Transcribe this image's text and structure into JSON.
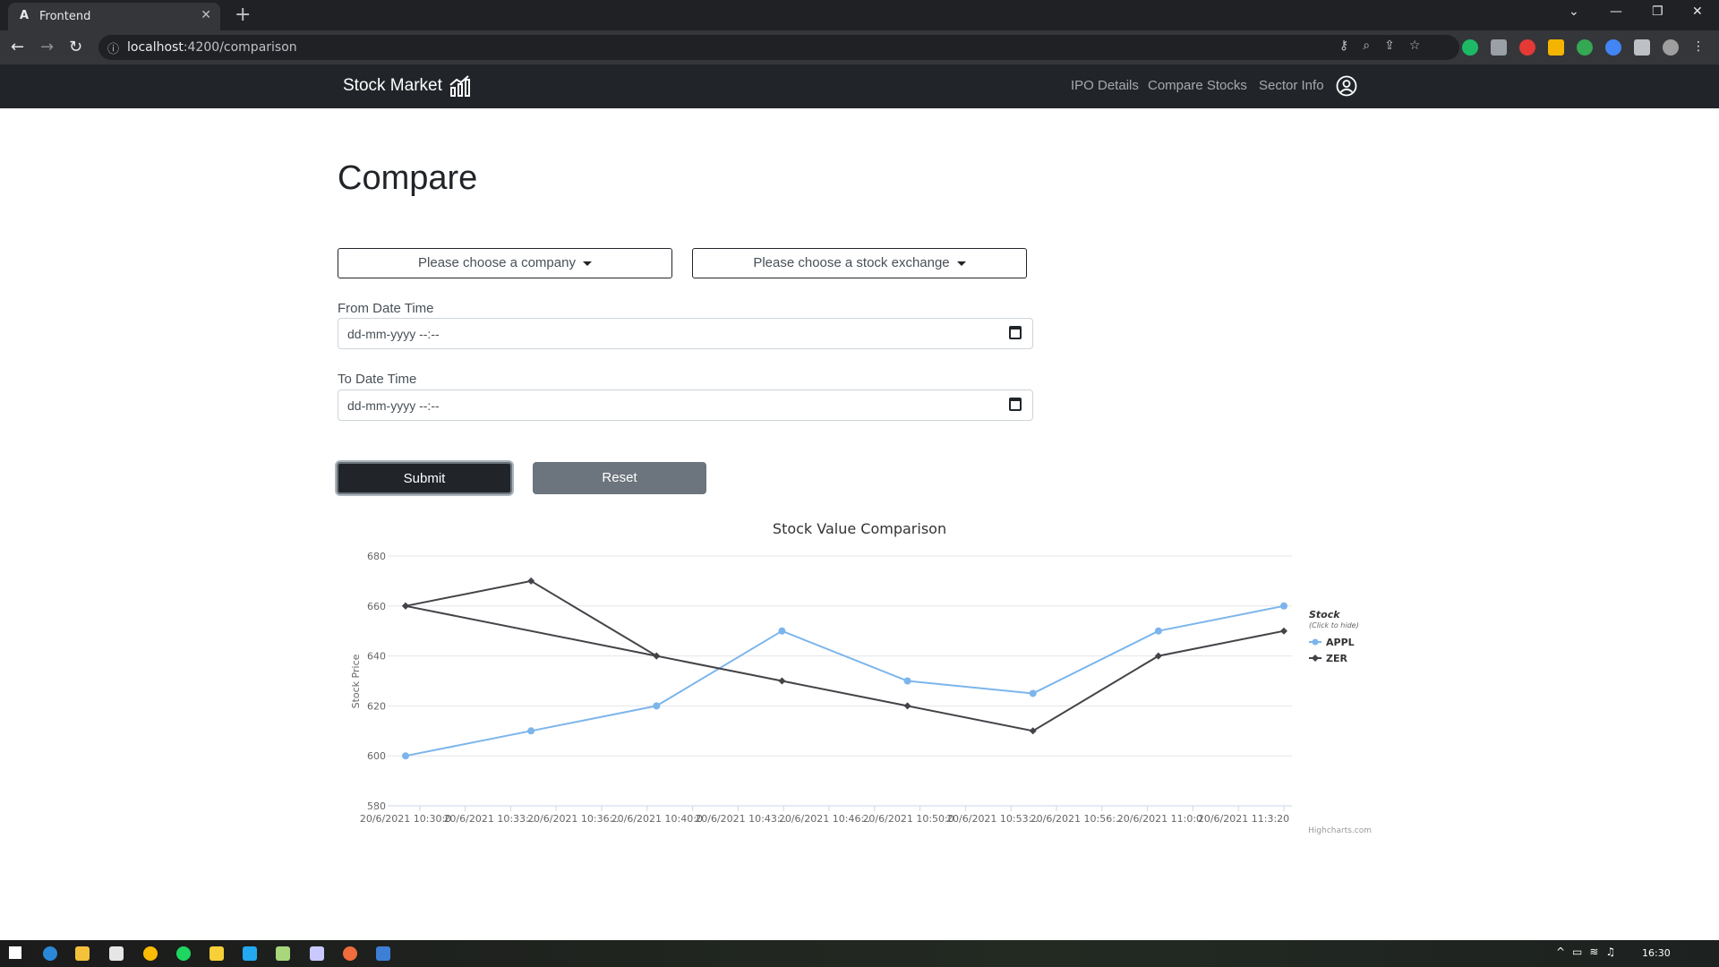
{
  "browser": {
    "tab_title": "Frontend",
    "tab_favicon": "A",
    "url_host": "localhost",
    "url_path": ":4200/comparison"
  },
  "navbar": {
    "brand": "Stock Market",
    "links": [
      "IPO Details",
      "Compare Stocks",
      "Sector Info"
    ]
  },
  "page": {
    "title": "Compare",
    "company_placeholder": "Please choose a company",
    "exchange_placeholder": "Please choose a stock exchange",
    "from_label": "From Date Time",
    "to_label": "To Date Time",
    "datetime_placeholder": "dd-mm-yyyy --:--",
    "submit_label": "Submit",
    "reset_label": "Reset"
  },
  "taskbar": {
    "time": "16:30"
  },
  "chart_data": {
    "type": "line",
    "title": "Stock Value Comparison",
    "ylabel": "Stock Price",
    "xlabel": "",
    "ylim": [
      580,
      680
    ],
    "yticks": [
      580,
      600,
      620,
      640,
      660,
      680
    ],
    "categories": [
      "20/6/2021 10:30:0",
      "20/6/2021 10:33:..",
      "20/6/2021 10:36:..",
      "20/6/2021 10:40:0",
      "20/6/2021 10:43:..",
      "20/6/2021 10:46:..",
      "20/6/2021 10:50:0",
      "20/6/2021 10:53:..",
      "20/6/2021 10:56:..",
      "20/6/2021 11:0:0",
      "20/6/2021 11:3:20"
    ],
    "series": [
      {
        "name": "APPL",
        "color": "#7cb5ec",
        "points": [
          [
            0,
            600
          ],
          [
            1,
            610
          ],
          [
            2,
            620
          ],
          [
            3,
            650
          ],
          [
            4,
            630
          ],
          [
            5,
            625
          ],
          [
            6,
            650
          ],
          [
            7,
            660
          ]
        ]
      },
      {
        "name": "ZER",
        "color": "#434348",
        "points": [
          [
            0,
            660
          ],
          [
            1,
            670
          ],
          [
            2,
            640
          ],
          [
            3,
            630
          ],
          [
            4,
            620
          ],
          [
            5,
            610
          ],
          [
            6,
            640
          ],
          [
            7,
            650
          ]
        ]
      },
      {
        "name": "ZER",
        "color": "#434348",
        "points": [
          [
            0,
            660
          ],
          [
            2,
            640
          ]
        ]
      }
    ],
    "legend": {
      "title": "Stock",
      "subtitle": "(Click to hide)",
      "position": "right"
    },
    "credits": "Highcharts.com"
  }
}
